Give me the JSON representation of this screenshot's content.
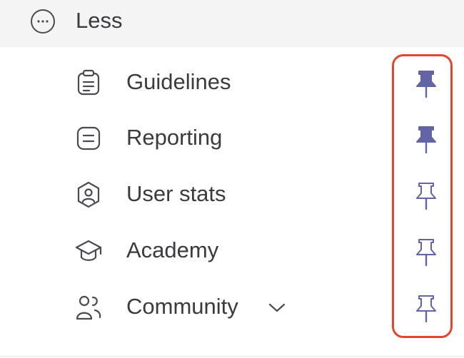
{
  "less_toggle": {
    "label": "Less",
    "icon": "ellipsis-circle-icon"
  },
  "nav_items": [
    {
      "label": "Guidelines",
      "icon": "clipboard-icon",
      "pinned": true
    },
    {
      "label": "Reporting",
      "icon": "list-box-icon",
      "pinned": true
    },
    {
      "label": "User stats",
      "icon": "user-shield-icon",
      "pinned": false
    },
    {
      "label": "Academy",
      "icon": "graduation-cap-icon",
      "pinned": false
    },
    {
      "label": "Community",
      "icon": "users-icon",
      "pinned": false,
      "has_dropdown": true
    }
  ],
  "colors": {
    "pin": "#6264a7",
    "highlight_border": "#e2462f",
    "text": "#3b3b3f",
    "less_row_bg": "#f4f4f5"
  }
}
